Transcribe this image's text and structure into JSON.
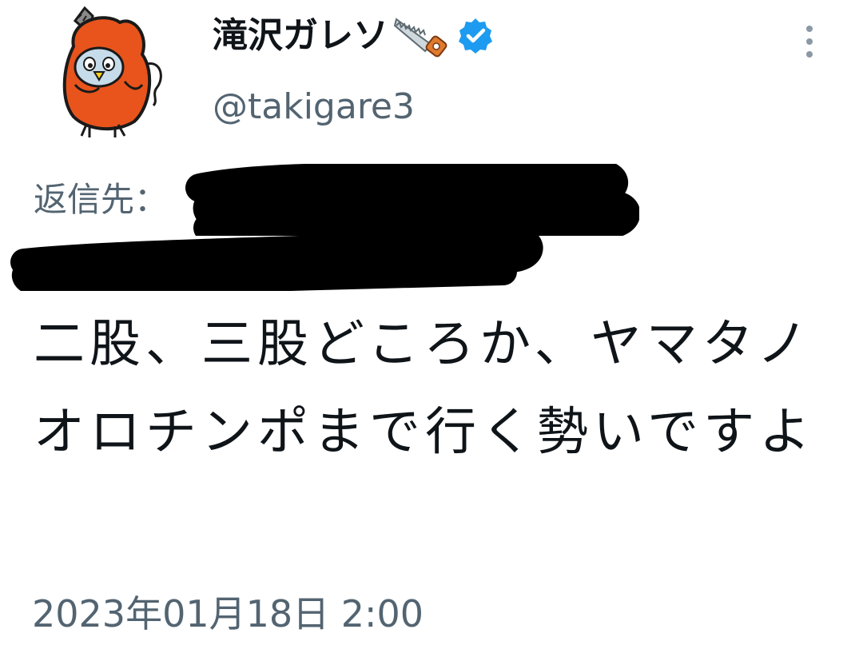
{
  "tweet": {
    "author": {
      "display_name": "滝沢ガレソ",
      "handle": "@takigare3",
      "verified": true,
      "name_emoji": "saw-icon",
      "avatar": "chainsaw-mascot-avatar"
    },
    "reply_label": "返信先：",
    "reply_targets_redacted": true,
    "text": "二股、三股どころか、ヤマタノオロチンポまで行く勢いですよ",
    "timestamp": "2023年01月18日 2:00"
  },
  "colors": {
    "text_primary": "#0f1419",
    "text_secondary": "#536471",
    "verified_blue": "#1d9bf0",
    "avatar_orange": "#e8541c",
    "redaction": "#000000"
  }
}
